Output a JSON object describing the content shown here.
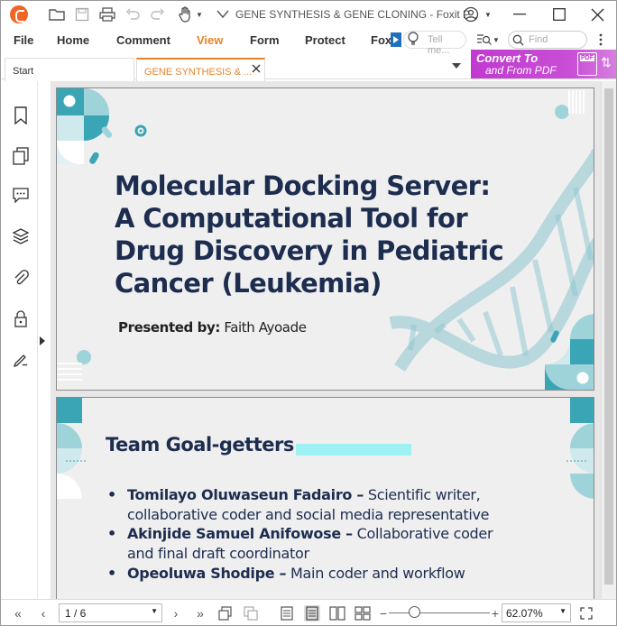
{
  "window": {
    "title": "GENE SYNTHESIS & GENE CLONING - Foxit P..."
  },
  "menu": {
    "items": [
      "File",
      "Home",
      "Comment",
      "View",
      "Form",
      "Protect",
      "Fox"
    ],
    "active": "View",
    "tell_me_placeholder": "Tell me...",
    "find_placeholder": "Find"
  },
  "tabs": {
    "start": "Start",
    "document": "GENE SYNTHESIS & ..."
  },
  "promo": {
    "line1": "Convert To",
    "line2": "and From PDF",
    "pdf_label": "PDF"
  },
  "slide1": {
    "title_lines": [
      "Molecular Docking Server:",
      "A Computational Tool for",
      "Drug Discovery in Pediatric",
      "Cancer (Leukemia)"
    ],
    "presented_label": "Presented by:",
    "presenter": "Faith Ayoade"
  },
  "slide2": {
    "heading": "Team Goal-getters",
    "members": [
      {
        "name": "Tomilayo Oluwaseun Fadairo –",
        "role": "Scientific writer, collaborative coder and social media representative"
      },
      {
        "name": "Akinjide Samuel Anifowose –",
        "role": "Collaborative coder and final draft coordinator"
      },
      {
        "name": "Opeoluwa Shodipe –",
        "role": "Main coder and workflow"
      }
    ]
  },
  "statusbar": {
    "page_indicator": "1 / 6",
    "zoom": "62.07%",
    "zoom_slider_fraction": 0.25
  },
  "colors": {
    "accent_orange": "#e8832a",
    "title_navy": "#1d2d4f",
    "teal": "#3aa5b5",
    "light_teal": "#9fd3da",
    "promo_purple": "#c13ad0"
  }
}
